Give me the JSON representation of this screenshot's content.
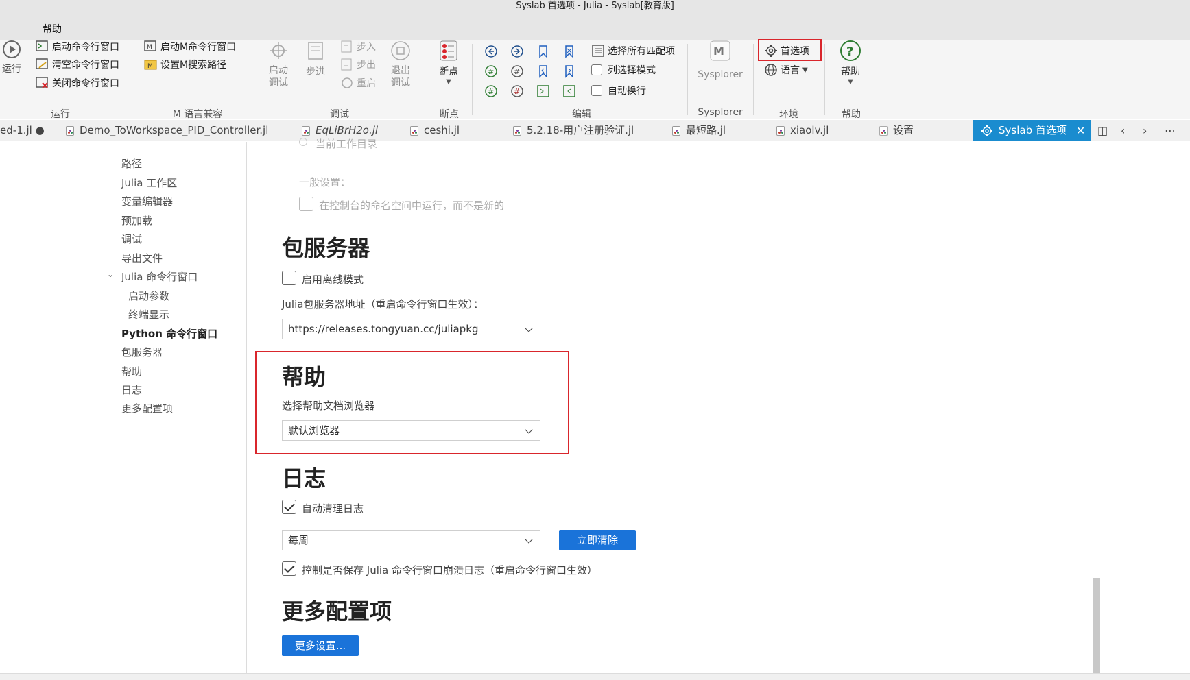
{
  "window": {
    "title": "Syslab 首选项 - Julia - Syslab[教育版]"
  },
  "menubar": {
    "help": "帮助"
  },
  "ribbon": {
    "run": {
      "run_label": "运行",
      "start_cmd": "启动命令行窗口",
      "clear_cmd": "清空命令行窗口",
      "close_cmd": "关闭命令行窗口",
      "group": "运行"
    },
    "m_lang": {
      "start_m": "启动M命令行窗口",
      "set_m_path": "设置M搜索路径",
      "group": "M 语言兼容"
    },
    "debug": {
      "start_debug": "启动\n调试",
      "step": "步进",
      "step_in": "步入",
      "step_out": "步出",
      "restart": "重启",
      "exit_debug": "退出\n调试",
      "group": "调试"
    },
    "breakpoints": {
      "label": "断点",
      "group": "断点"
    },
    "edit": {
      "select_all_matches": "选择所有匹配项",
      "column_select": "列选择模式",
      "word_wrap": "自动换行",
      "group": "编辑"
    },
    "sysplorer": {
      "label": "Sysplorer",
      "group": "Sysplorer"
    },
    "env": {
      "preferences": "首选项",
      "language": "语言",
      "group": "环境"
    },
    "help": {
      "label": "帮助",
      "group": "帮助"
    }
  },
  "tabs": [
    {
      "label": "ed-1.jl ●"
    },
    {
      "label": "Demo_ToWorkspace_PID_Controller.jl"
    },
    {
      "label": "EqLiBrH2o.jl"
    },
    {
      "label": "ceshi.jl"
    },
    {
      "label": "5.2.18-用户注册验证.jl"
    },
    {
      "label": "最短路.jl"
    },
    {
      "label": "xiaolv.jl"
    },
    {
      "label": "设置"
    },
    {
      "label": "Syslab 首选项"
    }
  ],
  "sidebar": {
    "items": [
      "路径",
      "Julia 工作区",
      "变量编辑器",
      "预加载",
      "调试",
      "导出文件",
      "Julia 命令行窗口",
      "启动参数",
      "终端显示",
      "Python 命令行窗口",
      "包服务器",
      "帮助",
      "日志",
      "更多配置项"
    ]
  },
  "content": {
    "top": {
      "current_dir": "当前工作目录",
      "general": "一般设置：",
      "run_in_namespace": "在控制台的命名空间中运行，而不是新的"
    },
    "pkg_server": {
      "title": "包服务器",
      "offline_mode": "启用离线模式",
      "address_label": "Julia包服务器地址（重启命令行窗口生效）：",
      "address_value": "https://releases.tongyuan.cc/juliapkg"
    },
    "help": {
      "title": "帮助",
      "browser_label": "选择帮助文档浏览器",
      "browser_value": "默认浏览器"
    },
    "log": {
      "title": "日志",
      "auto_clean": "自动清理日志",
      "period_value": "每周",
      "clear_now": "立即清除",
      "save_crash_log": "控制是否保存 Julia 命令行窗口崩溃日志（重启命令行窗口生效）"
    },
    "more": {
      "title": "更多配置项",
      "more_settings": "更多设置..."
    }
  }
}
